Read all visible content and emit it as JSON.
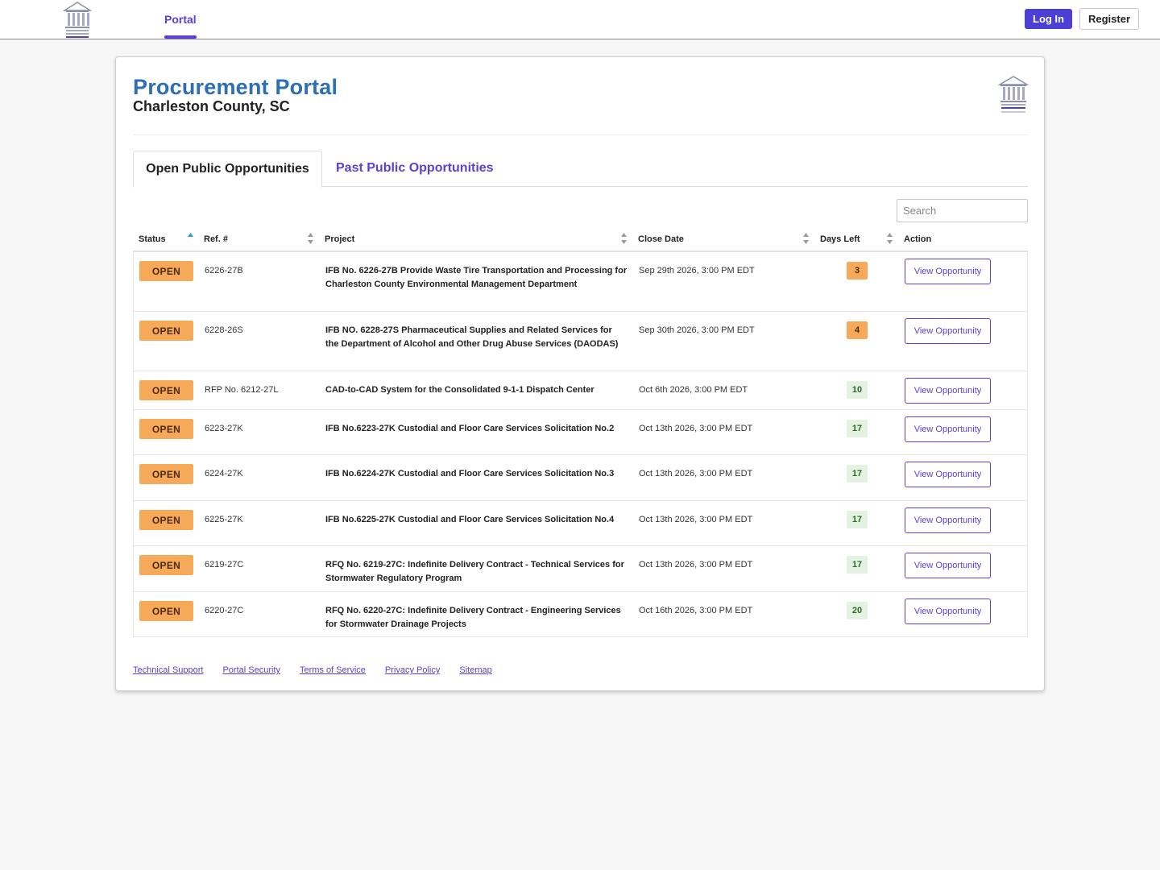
{
  "nav": {
    "portal_tab": "Portal",
    "login_label": "Log In",
    "register_label": "Register"
  },
  "header": {
    "title": "Procurement Portal",
    "subtitle": "Charleston County, SC"
  },
  "tabs": [
    {
      "label": "Open Public Opportunities",
      "active": true
    },
    {
      "label": "Past Public Opportunities",
      "active": false
    }
  ],
  "search": {
    "placeholder": "Search",
    "value": ""
  },
  "table": {
    "columns": [
      "Status",
      "Ref. #",
      "Project",
      "Close Date",
      "Days Left",
      "Action"
    ],
    "sorted_column": "Status",
    "rows": [
      {
        "status": "OPEN",
        "ref": "6226-27B",
        "project": "IFB No. 6226-27B Provide Waste Tire Transportation and Processing for Charleston County Environmental Management Department",
        "close_date": "Sep 29th 2026, 3:00 PM EDT",
        "days_left": "3",
        "days_color": "orange",
        "action": "View Opportunity"
      },
      {
        "status": "OPEN",
        "ref": "6228-26S",
        "project": "IFB NO. 6228-27S Pharmaceutical Supplies and Related Services for the Department of Alcohol and Other Drug Abuse Services (DAODAS)",
        "close_date": "Sep 30th 2026, 3:00 PM EDT",
        "days_left": "4",
        "days_color": "orange",
        "action": "View Opportunity"
      },
      {
        "status": "OPEN",
        "ref": "RFP No. 6212-27L",
        "project": "CAD-to-CAD System for the Consolidated 9-1-1 Dispatch Center",
        "close_date": "Oct 6th 2026, 3:00 PM EDT",
        "days_left": "10",
        "days_color": "green",
        "action": "View Opportunity"
      },
      {
        "status": "OPEN",
        "ref": "6223-27K",
        "project": "IFB No.6223-27K Custodial and Floor Care Services Solicitation No.2",
        "close_date": "Oct 13th 2026, 3:00 PM EDT",
        "days_left": "17",
        "days_color": "green",
        "action": "View Opportunity"
      },
      {
        "status": "OPEN",
        "ref": "6224-27K",
        "project": "IFB No.6224-27K Custodial and Floor Care Services Solicitation No.3",
        "close_date": "Oct 13th 2026, 3:00 PM EDT",
        "days_left": "17",
        "days_color": "green",
        "action": "View Opportunity"
      },
      {
        "status": "OPEN",
        "ref": "6225-27K",
        "project": "IFB No.6225-27K Custodial and Floor Care Services Solicitation No.4",
        "close_date": "Oct 13th 2026, 3:00 PM EDT",
        "days_left": "17",
        "days_color": "green",
        "action": "View Opportunity"
      },
      {
        "status": "OPEN",
        "ref": "6219-27C",
        "project": "RFQ No. 6219-27C: Indefinite Delivery Contract - Technical Services for Stormwater Regulatory Program",
        "close_date": "Oct 13th 2026, 3:00 PM EDT",
        "days_left": "17",
        "days_color": "green",
        "action": "View Opportunity"
      },
      {
        "status": "OPEN",
        "ref": "6220-27C",
        "project": "RFQ No. 6220-27C: Indefinite Delivery Contract - Engineering Services for Stormwater Drainage Projects",
        "close_date": "Oct 16th 2026, 3:00 PM EDT",
        "days_left": "20",
        "days_color": "green",
        "action": "View Opportunity"
      }
    ]
  },
  "footer": {
    "links": [
      "Technical Support",
      "Portal Security",
      "Terms of Service",
      "Privacy Policy",
      "Sitemap"
    ]
  },
  "colors": {
    "accent": "#5b3fd6",
    "title_blue": "#2e6fb4",
    "open_badge": "#f7a95a",
    "days_green_bg": "#e3f2e1"
  },
  "icons": {
    "logo": "charleston-county-courthouse-logo",
    "sort": "sort-arrows-icon"
  }
}
